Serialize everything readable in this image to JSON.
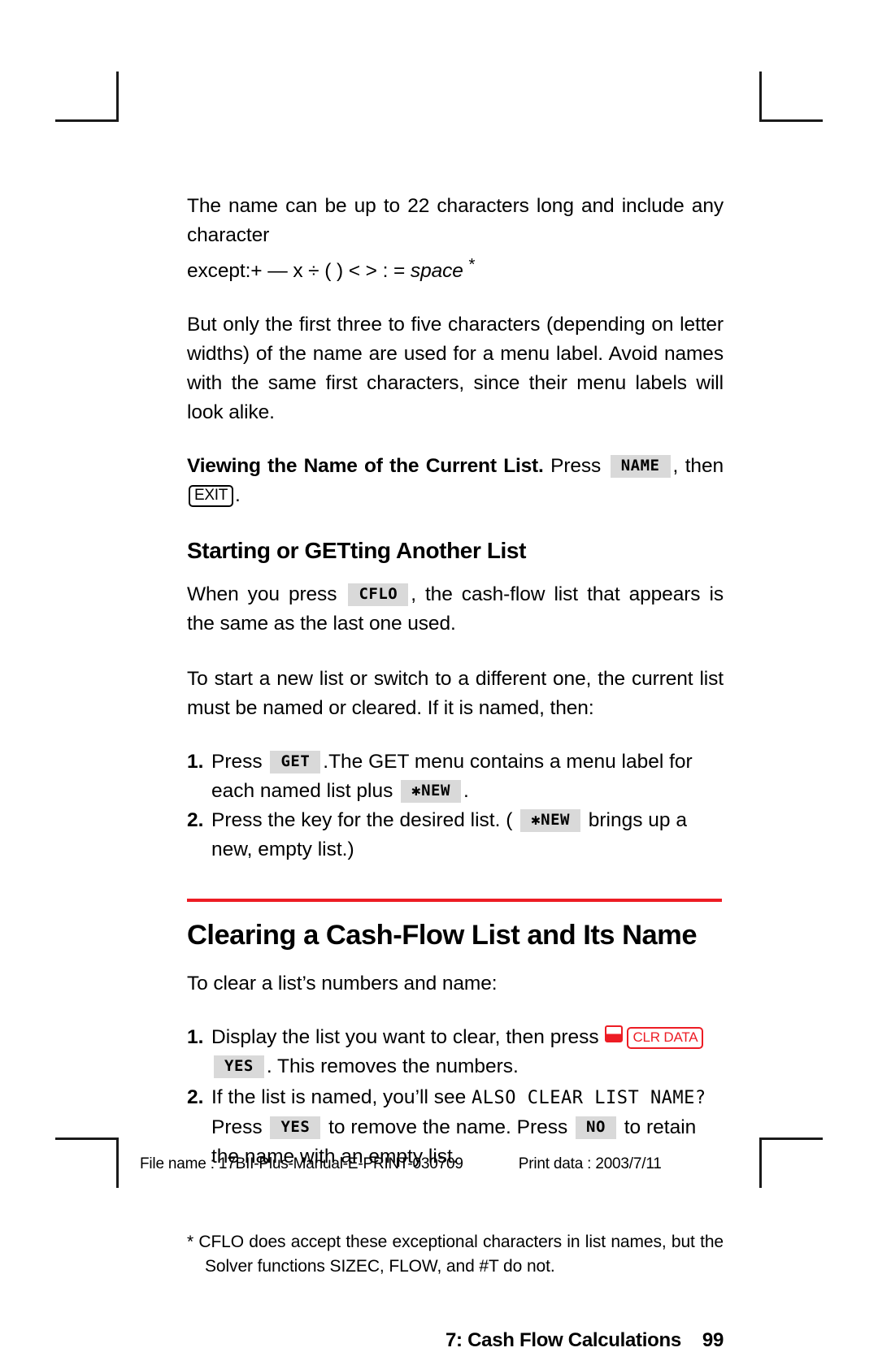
{
  "document": {
    "body": {
      "para_name_rules": "The name can be up to 22 characters long and include any character",
      "para_name_rules_except_prefix": "except:",
      "para_name_rules_except_chars": "+  —  x ÷ ( ) < > : = ",
      "para_name_rules_except_space": "space",
      "para_name_rules_footnote_mark": "*",
      "para_menu_label": "But only the first three to five characters (depending on letter widths) of the name are used for a menu label. Avoid names with the same first characters, since their menu labels will look alike.",
      "viewing_name_runin": "Viewing the Name of the Current List.",
      "viewing_name_press": "Press",
      "viewing_name_key": "NAME",
      "viewing_name_then": ", then",
      "viewing_name_exit": "EXIT",
      "viewing_name_end": ".",
      "section_heading": "Starting or GETting Another List",
      "cflo_para_1": "When you press",
      "cflo_key": "CFLO",
      "cflo_para_2": ", the cash-flow list that appears is the same as the last one used.",
      "start_new_para": "To start a new list or switch to a different one, the current list must be named or cleared. If it is named, then:",
      "chapter_heading": "Clearing a Cash-Flow List and Its Name",
      "clear_intro": "To clear a list’s numbers and name:",
      "display_prompt": "ALSO CLEAR LIST NAME?"
    },
    "steps_get": [
      {
        "num": "1.",
        "text_1": "Press",
        "key_1": "GET",
        "text_2": ".The GET menu contains a menu label for each named list plus",
        "key_2": "✱NEW",
        "text_3": "."
      },
      {
        "num": "2.",
        "text_1": "Press the key for the desired list. (",
        "key_1": "✱NEW",
        "text_2": "brings up a new, empty list.)"
      }
    ],
    "steps_clear": [
      {
        "num": "1.",
        "text_1": "Display the list you want to clear, then press",
        "shift_key": "shift-red",
        "key_1": "CLR DATA",
        "key_2": "YES",
        "text_2": ". This removes the numbers."
      },
      {
        "num": "2.",
        "text_1": "If the list is named, you’ll see",
        "display_text": "ALSO CLEAR LIST NAME?",
        "text_2": "Press",
        "key_1": "YES",
        "text_3": "to remove the name. Press",
        "key_2": "NO",
        "text_4": "to retain the name with an empty list."
      }
    ],
    "footnote": "* CFLO does accept these exceptional characters in list names, but the Solver functions SIZEC, FLOW, and #T do not.",
    "footer": {
      "chapter_title": "7: Cash Flow Calculations",
      "page_number": "99"
    },
    "printinfo": {
      "file_name": "File name : 17BII-Plus-Manual-E-PRINT-030709",
      "print_data": "Print data : 2003/7/11"
    },
    "colors": {
      "rule_red": "#ed1c24",
      "softkey_gray": "#d9d9d9"
    }
  }
}
